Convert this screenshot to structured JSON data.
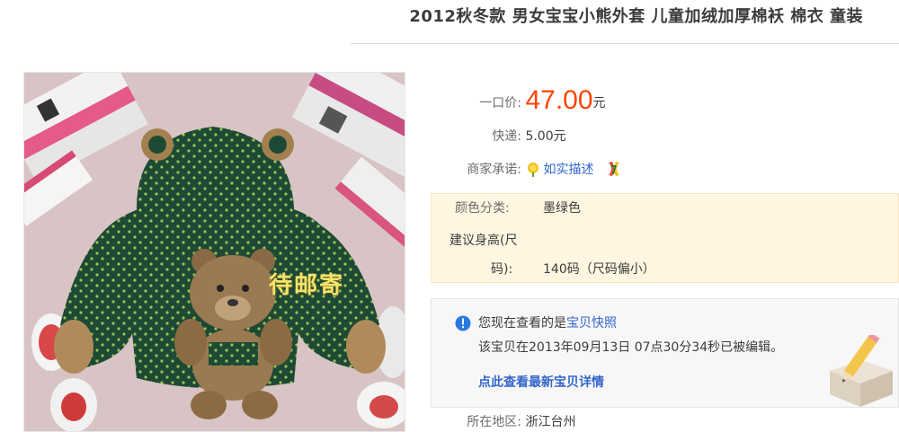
{
  "product": {
    "title": "2012秋冬款 男女宝宝小熊外套 儿童加绒加厚棉袄 棉衣 童装",
    "image": {
      "watermark": "待邮寄",
      "icon": "product-photo"
    },
    "price": {
      "label": "一口价:",
      "value": "47.00",
      "unit": "元"
    },
    "shipping": {
      "label": "快递:",
      "value": "5.00元"
    },
    "promise": {
      "label": "商家承诺:",
      "link": "如实描述",
      "icons": [
        "sun-flower-icon",
        "seven-day-return-icon"
      ]
    },
    "specs": {
      "color_label": "颜色分类:",
      "color_value": "墨绿色",
      "height_label_1": "建议身高(尺",
      "height_label_2": "码):",
      "height_value": "140码（尺码偏小）"
    },
    "snapshot": {
      "notice_prefix": "您现在查看的是",
      "notice_link": "宝贝快照",
      "edited_text": "该宝贝在2013年09月13日  07点30分34秒已被编辑。",
      "latest_link": "点此查看最新宝贝详情"
    },
    "location": {
      "label": "所在地区:",
      "value": "浙江台州"
    }
  },
  "colors": {
    "price": "#ff4400",
    "link": "#3366cc",
    "spec_bg": "#fff6e1",
    "snapshot_bg": "#f7f7f7"
  }
}
